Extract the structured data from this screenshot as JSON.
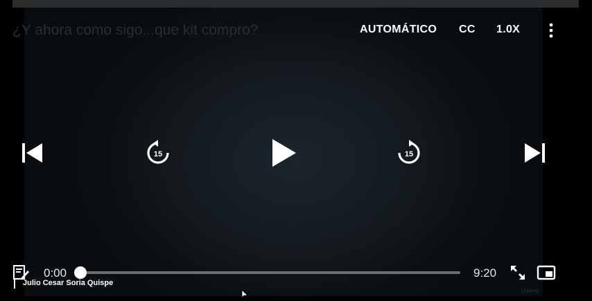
{
  "video": {
    "title": "¿Y ahora como sigo...que kit compro?",
    "watermark": "Udemy"
  },
  "top_controls": {
    "quality_label": "AUTOMÁTICO",
    "captions_label": "CC",
    "speed_label": "1.0X",
    "more_icon": "vertical-ellipsis-icon"
  },
  "playback": {
    "previous_icon": "skip-previous-icon",
    "rewind_icon": "rewind-15-icon",
    "rewind_seconds": "15",
    "play_icon": "play-icon",
    "forward_icon": "forward-15-icon",
    "forward_seconds": "15",
    "next_icon": "skip-next-icon"
  },
  "progress": {
    "current_time": "0:00",
    "duration": "9:20",
    "fraction_played": 0.0
  },
  "bottom_controls": {
    "transcript_icon": "transcript-notes-icon",
    "fullscreen_icon": "expand-icon",
    "pip_icon": "picture-in-picture-icon"
  },
  "author": {
    "name": "Julio Cesar Soria Quispe"
  },
  "colors": {
    "background": "#000000",
    "controls": "#ffffff",
    "track": "#6b6f72"
  }
}
